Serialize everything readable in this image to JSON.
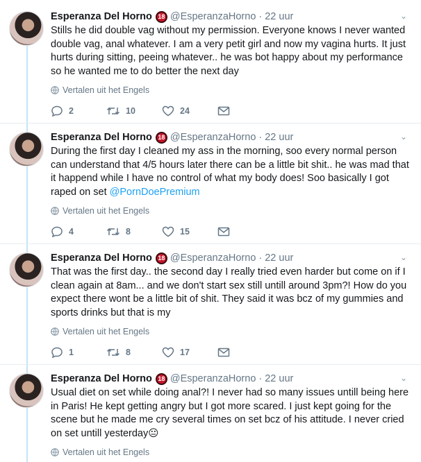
{
  "tweets": [
    {
      "name": "Esperanza Del Horno",
      "badge": "18",
      "handle": "@EsperanzaHorno",
      "time": "22 uur",
      "text": "Stills he did double vag without my permission. Everyone knows I never wanted double vag, anal whatever. I am a very petit girl and now my vagina hurts. It just hurts during sitting, peeing whatever.. he was bot happy about my performance so he wanted me to do better the next day",
      "mention": "",
      "emoji": "",
      "translate": "Vertalen uit het Engels",
      "replies": "2",
      "retweets": "10",
      "likes": "24"
    },
    {
      "name": "Esperanza Del Horno",
      "badge": "18",
      "handle": "@EsperanzaHorno",
      "time": "22 uur",
      "text": "During the first day I cleaned my ass in the morning, soo every normal person can understand that 4/5 hours later there can be a little bit shit.. he was mad that it happend while I have no control of what my body does! Soo basically I got raped on set ",
      "mention": "@PornDoePremium",
      "emoji": "",
      "translate": "Vertalen uit het Engels",
      "replies": "4",
      "retweets": "8",
      "likes": "15"
    },
    {
      "name": "Esperanza Del Horno",
      "badge": "18",
      "handle": "@EsperanzaHorno",
      "time": "22 uur",
      "text": "That was the first day.. the second day I really tried even harder but come on if I clean again at 8am... and we don't start sex still untill around 3pm?! How do you expect there wont be a little bit of shit. They said it was bcz of my gummies and sports drinks but that is my",
      "mention": "",
      "emoji": "",
      "translate": "Vertalen uit het Engels",
      "replies": "1",
      "retweets": "8",
      "likes": "17"
    },
    {
      "name": "Esperanza Del Horno",
      "badge": "18",
      "handle": "@EsperanzaHorno",
      "time": "22 uur",
      "text": "Usual diet on set while doing anal?! I never had so many issues untill being here in Paris! He kept getting angry but I got more scared. I just kept going for the scene but he made me cry several times on set bcz of his attitude. I never cried on set untill yesterday",
      "mention": "",
      "emoji": "😐",
      "translate": "Vertalen uit het Engels",
      "replies": "",
      "retweets": "",
      "likes": ""
    }
  ]
}
